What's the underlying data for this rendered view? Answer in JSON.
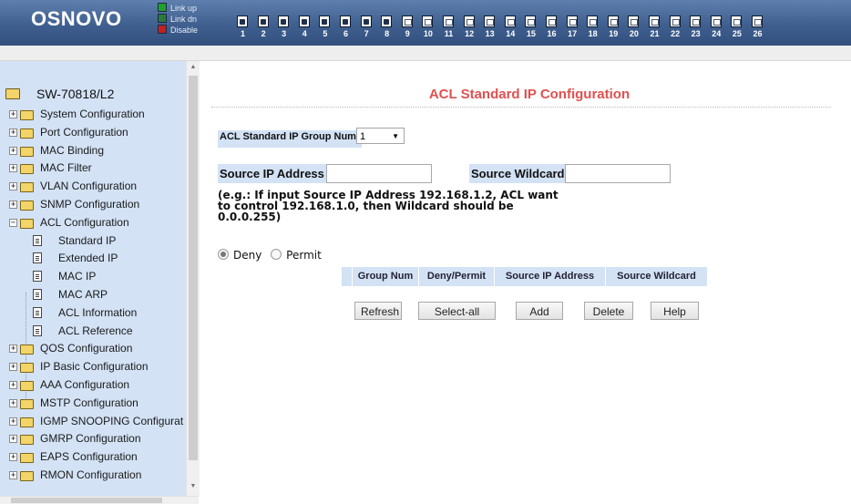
{
  "header": {
    "logo": "OSNOVO",
    "legend": [
      {
        "label": "Link up",
        "color": "#1ea12a"
      },
      {
        "label": "Link dn",
        "color": "#2b7a3a"
      },
      {
        "label": "Disable",
        "color": "#c42020"
      }
    ],
    "ports": [
      {
        "num": "1",
        "state": "up"
      },
      {
        "num": "2",
        "state": "up"
      },
      {
        "num": "3",
        "state": "up"
      },
      {
        "num": "4",
        "state": "up"
      },
      {
        "num": "5",
        "state": "up"
      },
      {
        "num": "6",
        "state": "up"
      },
      {
        "num": "7",
        "state": "up"
      },
      {
        "num": "8",
        "state": "up"
      },
      {
        "num": "9",
        "state": "dis"
      },
      {
        "num": "10",
        "state": "dis"
      },
      {
        "num": "11",
        "state": "dis"
      },
      {
        "num": "12",
        "state": "dis"
      },
      {
        "num": "13",
        "state": "dis"
      },
      {
        "num": "14",
        "state": "dis"
      },
      {
        "num": "15",
        "state": "dis"
      },
      {
        "num": "16",
        "state": "dis"
      },
      {
        "num": "17",
        "state": "dis"
      },
      {
        "num": "18",
        "state": "dis"
      },
      {
        "num": "19",
        "state": "dis"
      },
      {
        "num": "20",
        "state": "dis"
      },
      {
        "num": "21",
        "state": "dis"
      },
      {
        "num": "22",
        "state": "dis"
      },
      {
        "num": "23",
        "state": "dis"
      },
      {
        "num": "24",
        "state": "dis"
      },
      {
        "num": "25",
        "state": "dis"
      },
      {
        "num": "26",
        "state": "dis"
      }
    ]
  },
  "sidebar": {
    "root": "SW-70818/L2",
    "items": [
      {
        "label": "System Configuration",
        "icon": "folder-icon",
        "expanded": false
      },
      {
        "label": "Port Configuration",
        "icon": "folder-icon",
        "expanded": false
      },
      {
        "label": "MAC Binding",
        "icon": "folder-icon",
        "expanded": false
      },
      {
        "label": "MAC Filter",
        "icon": "folder-icon",
        "expanded": false
      },
      {
        "label": "VLAN Configuration",
        "icon": "folder-icon",
        "expanded": false
      },
      {
        "label": "SNMP Configuration",
        "icon": "folder-icon",
        "expanded": false
      },
      {
        "label": "ACL Configuration",
        "icon": "folder-open-icon",
        "expanded": true
      },
      {
        "label": "Standard IP",
        "icon": "document-icon",
        "child": true
      },
      {
        "label": "Extended IP",
        "icon": "document-icon",
        "child": true
      },
      {
        "label": "MAC IP",
        "icon": "document-icon",
        "child": true
      },
      {
        "label": "MAC ARP",
        "icon": "document-icon",
        "child": true
      },
      {
        "label": "ACL Information",
        "icon": "document-icon",
        "child": true
      },
      {
        "label": "ACL Reference",
        "icon": "document-icon",
        "child": true
      },
      {
        "label": "QOS Configuration",
        "icon": "folder-icon",
        "expanded": false
      },
      {
        "label": "IP Basic Configuration",
        "icon": "folder-icon",
        "expanded": false
      },
      {
        "label": "AAA Configuration",
        "icon": "folder-icon",
        "expanded": false
      },
      {
        "label": "MSTP Configuration",
        "icon": "folder-icon",
        "expanded": false
      },
      {
        "label": "IGMP SNOOPING Configurat",
        "icon": "folder-icon",
        "expanded": false
      },
      {
        "label": "GMRP Configuration",
        "icon": "folder-icon",
        "expanded": false
      },
      {
        "label": "EAPS Configuration",
        "icon": "folder-icon",
        "expanded": false
      },
      {
        "label": "RMON Configuration",
        "icon": "folder-icon",
        "expanded": false
      }
    ]
  },
  "main": {
    "title": "ACL Standard IP Configuration",
    "group": {
      "label": "ACL Standard IP Group Num:",
      "value": "1"
    },
    "source_ip": {
      "label": "Source IP Address",
      "value": ""
    },
    "source_wildcard": {
      "label": "Source Wildcard",
      "value": ""
    },
    "hint": "(e.g.: If input Source IP Address 192.168.1.2, ACL want to control 192.168.1.0, then Wildcard should be 0.0.0.255)",
    "actions": {
      "deny": "Deny",
      "permit": "Permit",
      "selected": "deny"
    },
    "table_columns": [
      "",
      "Group Num",
      "Deny/Permit",
      "Source IP Address",
      "Source Wildcard"
    ],
    "buttons": {
      "refresh": "Refresh",
      "select_all": "Select-all",
      "add": "Add",
      "delete": "Delete",
      "help": "Help"
    }
  },
  "colors": {
    "header": "#3f5f8f",
    "sidebar": "#d3e2f5",
    "title": "#e05050"
  }
}
